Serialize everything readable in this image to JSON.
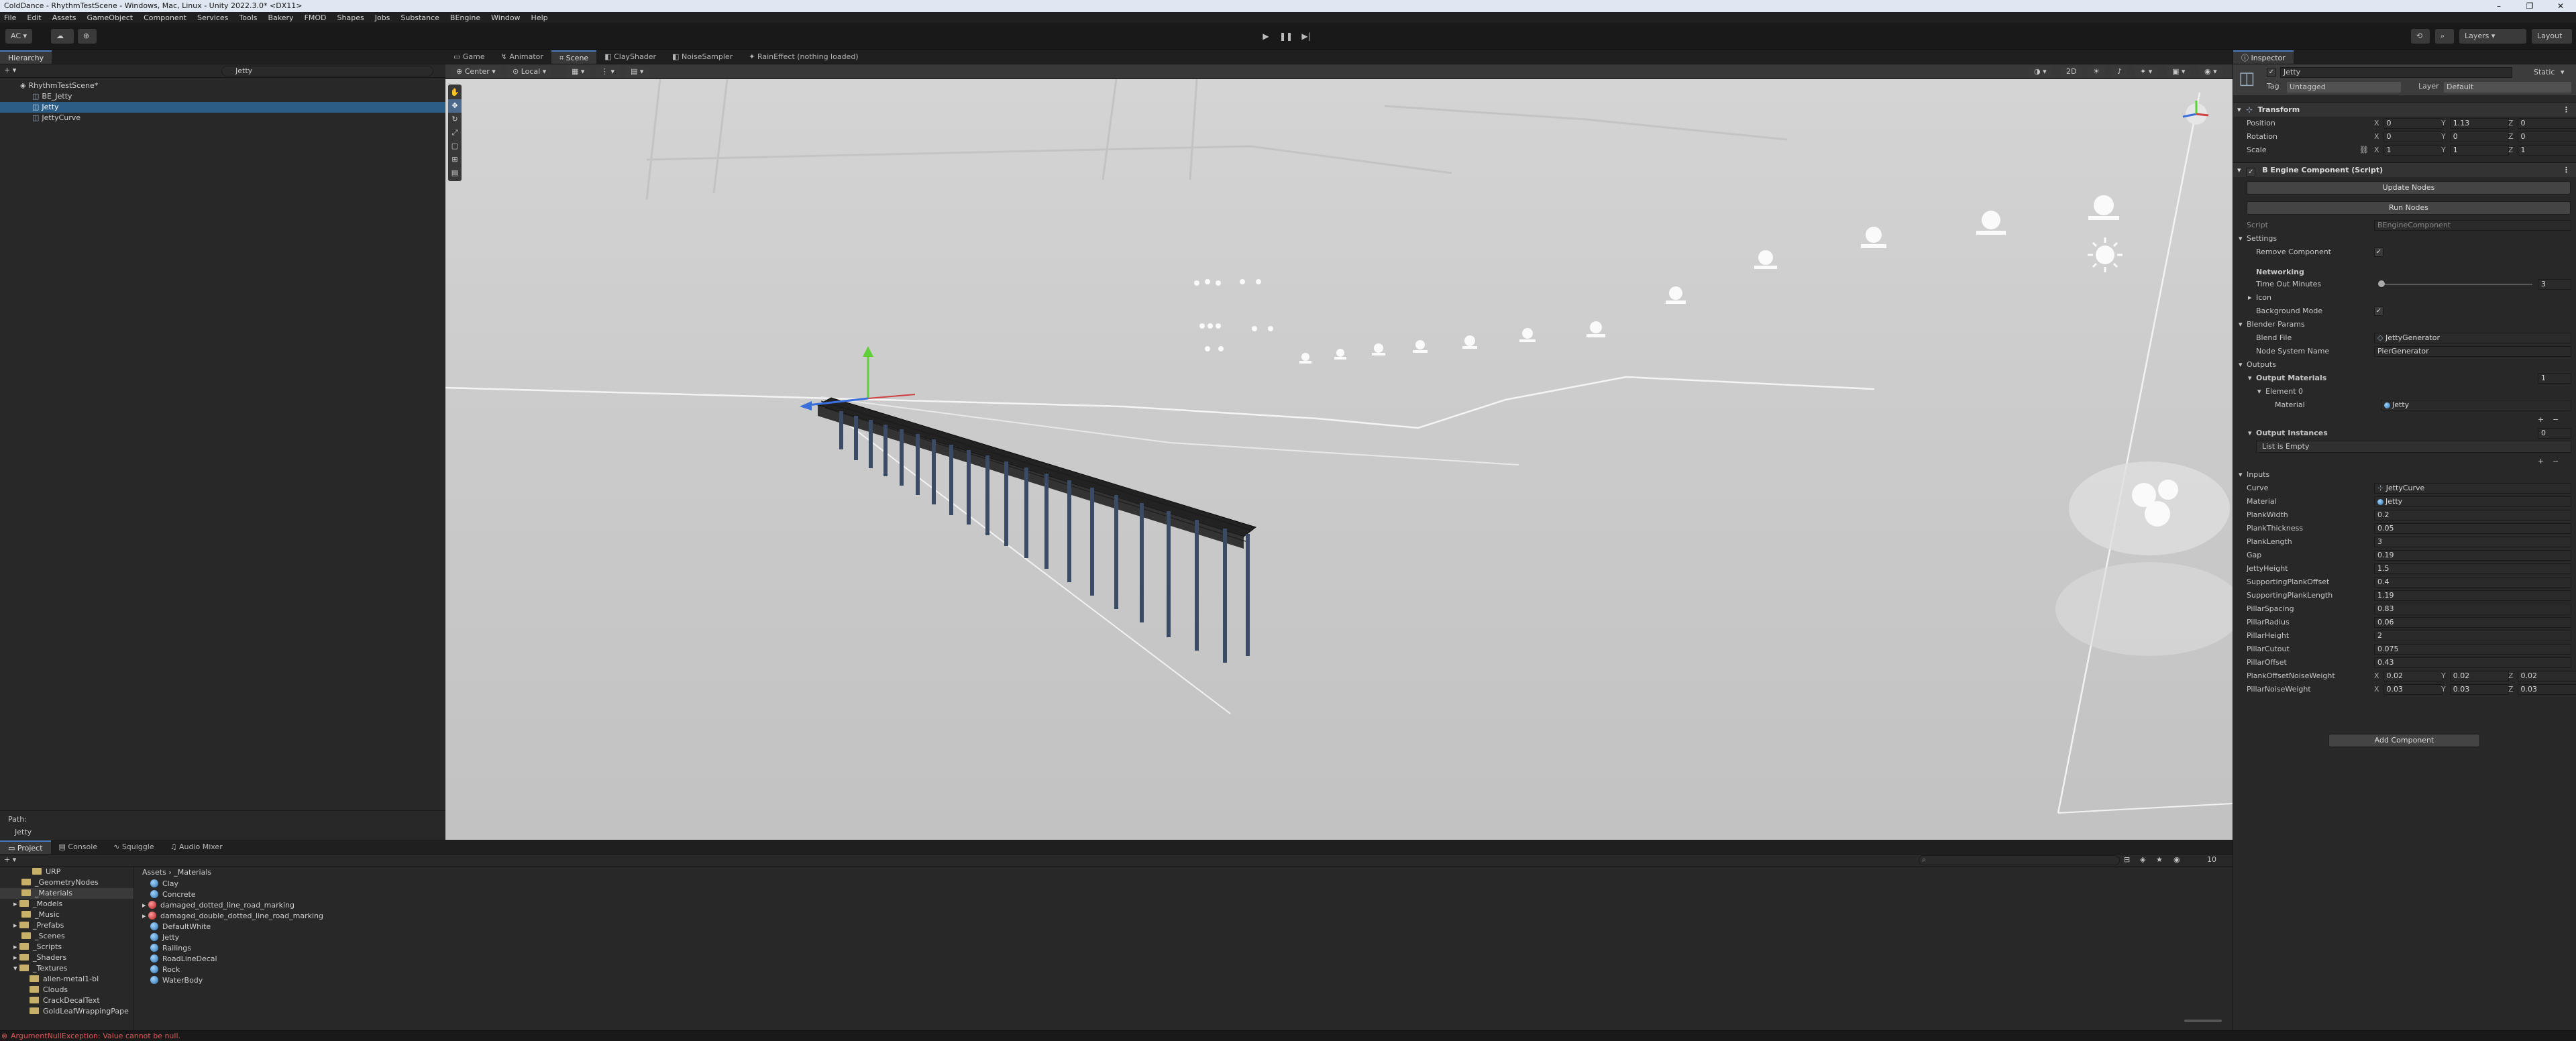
{
  "window": {
    "title": "ColdDance - RhythmTestScene - Windows, Mac, Linux - Unity 2022.3.0* <DX11>",
    "controls": [
      "–",
      "❐",
      "✕"
    ]
  },
  "menu": [
    "File",
    "Edit",
    "Assets",
    "GameObject",
    "Component",
    "Services",
    "Tools",
    "Bakery",
    "FMOD",
    "Shapes",
    "Jobs",
    "Substance",
    "BEngine",
    "Window",
    "Help"
  ],
  "toolbar": {
    "account": "AC",
    "layers": "Layers",
    "layout": "Layout"
  },
  "hierarchy": {
    "tab": "Hierarchy",
    "search": "Jetty",
    "items": [
      {
        "label": "RhythmTestScene*",
        "indent": 0,
        "selected": false
      },
      {
        "label": "BE_Jetty",
        "indent": 1,
        "selected": false
      },
      {
        "label": "Jetty",
        "indent": 1,
        "selected": true
      },
      {
        "label": "JettyCurve",
        "indent": 1,
        "selected": false
      }
    ],
    "path_label": "Path:",
    "path_value": "Jetty"
  },
  "scene_tabs": [
    {
      "label": "Game",
      "active": false
    },
    {
      "label": "Animator",
      "active": false
    },
    {
      "label": "Scene",
      "active": true
    },
    {
      "label": "ClayShader",
      "active": false
    },
    {
      "label": "NoiseSampler",
      "active": false
    },
    {
      "label": "RainEffect (nothing loaded)",
      "active": false
    }
  ],
  "scene_toolbar": {
    "pivot": "Center",
    "space": "Local"
  },
  "inspector": {
    "tab": "Inspector",
    "object_name": "Jetty",
    "static_label": "Static",
    "tag_label": "Tag",
    "tag_value": "Untagged",
    "layer_label": "Layer",
    "layer_value": "Default",
    "transform": {
      "title": "Transform",
      "position_label": "Position",
      "position": [
        "0",
        "1.13",
        "0"
      ],
      "rotation_label": "Rotation",
      "rotation": [
        "0",
        "0",
        "0"
      ],
      "scale_label": "Scale",
      "scale": [
        "1",
        "1",
        "1"
      ]
    },
    "bengine": {
      "title": "B Engine Component (Script)",
      "update_button": "Update Nodes",
      "run_button": "Run Nodes",
      "script_label": "Script",
      "script_value": "BEngineComponent",
      "settings_label": "Settings",
      "remove_component_label": "Remove Component",
      "networking_label": "Networking",
      "timeout_label": "Time Out Minutes",
      "timeout_value": "3",
      "icon_label": "Icon",
      "background_mode_label": "Background Mode",
      "blender_params_label": "Blender Params",
      "blend_file_label": "Blend File",
      "blend_file_value": "JettyGenerator",
      "node_system_label": "Node System Name",
      "node_system_value": "PierGenerator",
      "outputs_label": "Outputs",
      "output_materials_label": "Output Materials",
      "output_materials_count": "1",
      "element0_label": "Element 0",
      "material_label": "Material",
      "material_value": "Jetty",
      "output_instances_label": "Output Instances",
      "output_instances_count": "0",
      "list_empty": "List is Empty",
      "inputs_label": "Inputs",
      "inputs": [
        {
          "label": "Curve",
          "value": "JettyCurve"
        },
        {
          "label": "Material",
          "value": "Jetty"
        },
        {
          "label": "PlankWidth",
          "value": "0.2"
        },
        {
          "label": "PlankThickness",
          "value": "0.05"
        },
        {
          "label": "PlankLength",
          "value": "3"
        },
        {
          "label": "Gap",
          "value": "0.19"
        },
        {
          "label": "JettyHeight",
          "value": "1.5"
        },
        {
          "label": "SupportingPlankOffset",
          "value": "0.4"
        },
        {
          "label": "SupportingPlankLength",
          "value": "1.19"
        },
        {
          "label": "PillarSpacing",
          "value": "0.83"
        },
        {
          "label": "PillarRadius",
          "value": "0.06"
        },
        {
          "label": "PillarHeight",
          "value": "2"
        },
        {
          "label": "PillarCutout",
          "value": "0.075"
        },
        {
          "label": "PillarOffset",
          "value": "0.43"
        }
      ],
      "plank_offset_noise_label": "PlankOffsetNoiseWeight",
      "plank_offset_noise": [
        "0.02",
        "0.02",
        "0.02"
      ],
      "pillar_noise_label": "PillarNoiseWeight",
      "pillar_noise": [
        "0.03",
        "0.03",
        "0.03"
      ]
    },
    "add_component": "Add Component"
  },
  "project": {
    "tabs": [
      "Project",
      "Console",
      "Squiggle",
      "Audio Mixer"
    ],
    "breadcrumb": [
      "Assets",
      "_Materials"
    ],
    "folders": [
      "URP",
      "_GeometryNodes",
      "_Materials",
      "_Models",
      "_Music",
      "_Prefabs",
      "_Scenes",
      "_Scripts",
      "_Shaders",
      "_Textures",
      "alien-metal1-bl",
      "Clouds",
      "CrackDecalText",
      "GoldLeafWrappingPape"
    ],
    "assets": [
      {
        "name": "Clay",
        "kind": "material"
      },
      {
        "name": "Concrete",
        "kind": "material"
      },
      {
        "name": "damaged_dotted_line_road_marking",
        "kind": "missing"
      },
      {
        "name": "damaged_double_dotted_line_road_marking",
        "kind": "missing"
      },
      {
        "name": "DefaultWhite",
        "kind": "material"
      },
      {
        "name": "Jetty",
        "kind": "material"
      },
      {
        "name": "Railings",
        "kind": "material"
      },
      {
        "name": "RoadLineDecal",
        "kind": "material"
      },
      {
        "name": "Rock",
        "kind": "material"
      },
      {
        "name": "WaterBody",
        "kind": "material"
      }
    ],
    "count": "10"
  },
  "status": {
    "message": "ArgumentNullException: Value cannot be null."
  }
}
